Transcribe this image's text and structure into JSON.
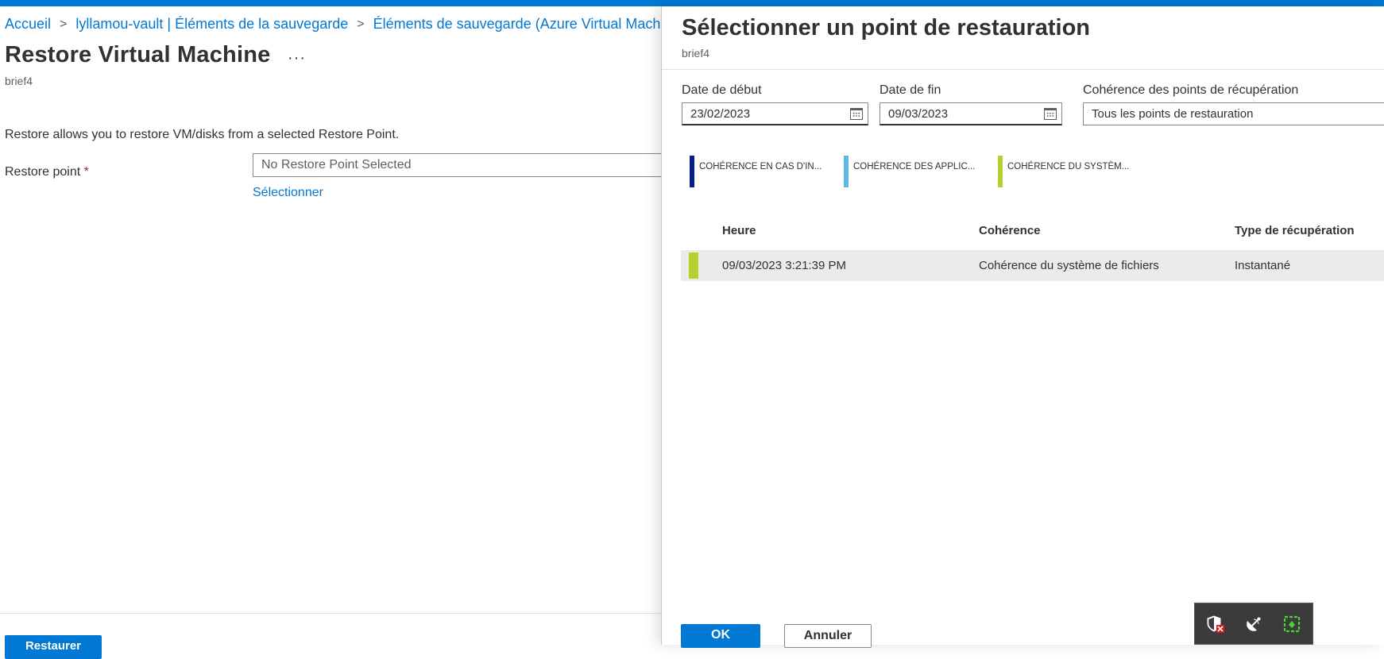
{
  "breadcrumb": {
    "items": [
      "Accueil",
      "lyllamou-vault | Éléments de la sauvegarde",
      "Éléments de sauvegarde (Azure Virtual Machine)"
    ],
    "separator": ">"
  },
  "page": {
    "title": "Restore Virtual Machine",
    "more_label": "···",
    "subtitle": "brief4",
    "description": "Restore allows you to restore VM/disks from a selected Restore Point.",
    "restore_point_label": "Restore point",
    "required_marker": "*",
    "restore_point_value": "No Restore Point Selected",
    "select_link": "Sélectionner",
    "restore_button": "Restaurer"
  },
  "panel": {
    "title": "Sélectionner un point de restauration",
    "subtitle": "brief4",
    "start_date": {
      "label": "Date de début",
      "value": "23/02/2023",
      "icon": "calendar-icon"
    },
    "end_date": {
      "label": "Date de fin",
      "value": "09/03/2023",
      "icon": "calendar-icon"
    },
    "consistency_filter": {
      "label": "Cohérence des points de récupération",
      "value": "Tous les points de restauration"
    },
    "legend": [
      {
        "label": "COHÉRENCE EN CAS D'IN...",
        "color": "#0a1e8a"
      },
      {
        "label": "COHÉRENCE DES APPLIC...",
        "color": "#5cb8e0"
      },
      {
        "label": "COHÉRENCE DU SYSTÈM...",
        "color": "#b5d12d"
      }
    ],
    "table": {
      "columns": [
        "Heure",
        "Cohérence",
        "Type de récupération"
      ],
      "rows": [
        {
          "time": "09/03/2023 3:21:39 PM",
          "consistency": "Cohérence du système de fichiers",
          "type": "Instantané",
          "color": "#b5d12d"
        }
      ]
    },
    "ok_button": "OK",
    "cancel_button": "Annuler"
  },
  "tray": {
    "icons": [
      "shield-warning-icon",
      "satellite-dish-icon",
      "app-tray-icon"
    ]
  },
  "colors": {
    "accent": "#0078d4",
    "row_highlight": "#edebe9"
  }
}
